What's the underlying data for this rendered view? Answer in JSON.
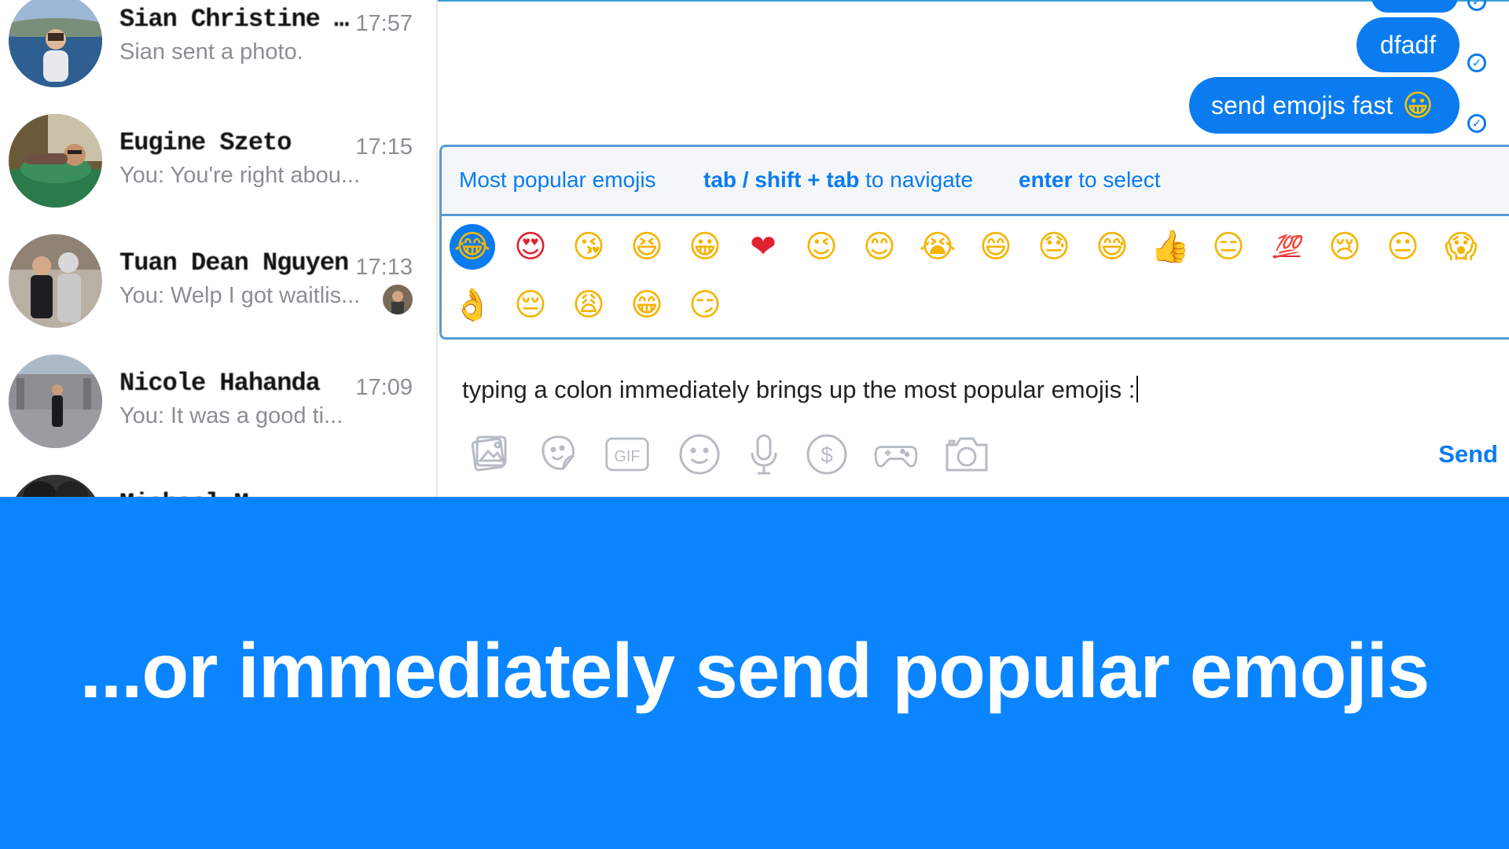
{
  "conversations": [
    {
      "name": "Sian Christine W...",
      "time": "17:57",
      "snippet": "Sian sent a photo."
    },
    {
      "name": "Eugine Szeto",
      "time": "17:15",
      "snippet": "You: You're right abou..."
    },
    {
      "name": "Tuan Dean Nguyen",
      "time": "17:13",
      "snippet": "You: Welp I got waitlis..."
    },
    {
      "name": "Nicole Hahanda",
      "time": "17:09",
      "snippet": "You: It was a good ti..."
    },
    {
      "name": "Michael M...",
      "time": "",
      "snippet": ""
    }
  ],
  "messages": [
    {
      "text": "dfadf"
    },
    {
      "text": "send emojis fast",
      "emoji": "😀"
    }
  ],
  "emoji_panel": {
    "title": "Most popular emojis",
    "nav_keys": "tab / shift + tab",
    "nav_suffix": " to navigate",
    "select_key": "enter",
    "select_suffix": " to select",
    "row1": [
      "😂",
      "😍",
      "😘",
      "😆",
      "😀",
      "❤",
      "😉",
      "😊",
      "😭",
      "😄",
      "😓",
      "😅",
      "👍",
      "😑",
      "💯",
      "😢",
      "😐",
      "😱"
    ],
    "row2": [
      "👌",
      "😔",
      "😩",
      "😁",
      "😏"
    ]
  },
  "composer": {
    "text": "typing a colon immediately brings up the most popular emojis :",
    "send_label": "Send",
    "tools": [
      "photo-icon",
      "sticker-icon",
      "gif-icon",
      "emoji-icon",
      "microphone-icon",
      "payment-icon",
      "game-icon",
      "camera-icon"
    ],
    "gif_label": "GIF"
  },
  "caption": "...or immediately send popular emojis",
  "colors": {
    "accent": "#0a7cf0",
    "banner": "#0a85ff"
  }
}
